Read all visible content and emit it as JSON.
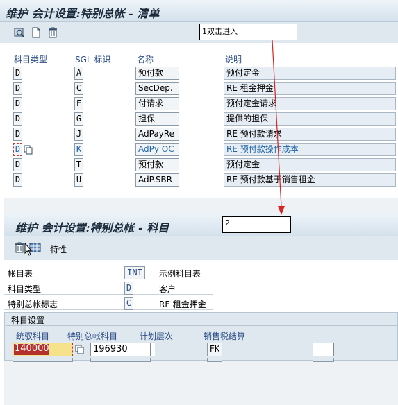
{
  "list_view": {
    "title": "维护 会计设置:特别总帐 - 清单",
    "callout": "1双击进入",
    "columns": {
      "type": "科目类型",
      "sgl": "SGL 标识",
      "name": "名称",
      "desc": "说明"
    },
    "rows": [
      {
        "type": "D",
        "sgl": "A",
        "name": "预付款",
        "desc": "预付定金"
      },
      {
        "type": "D",
        "sgl": "C",
        "name": "SecDep.",
        "desc": "RE 租金押金"
      },
      {
        "type": "D",
        "sgl": "F",
        "name": "付请求",
        "desc": "预付定金请求"
      },
      {
        "type": "D",
        "sgl": "G",
        "name": "担保",
        "desc": "提供的担保"
      },
      {
        "type": "D",
        "sgl": "J",
        "name": "AdPayRe",
        "desc": "RE 预付款请求"
      },
      {
        "type": "D",
        "sgl": "K",
        "name": "AdPy OC",
        "desc": "RE 预付款操作成本"
      },
      {
        "type": "D",
        "sgl": "T",
        "name": "预付款",
        "desc": "预付定金"
      },
      {
        "type": "D",
        "sgl": "U",
        "name": "AdP.SBR",
        "desc": "RE 预付款基于销售租金"
      }
    ]
  },
  "detail_view": {
    "title": "维护 会计设置:特别总帐 - 科目",
    "callout": "2",
    "toolbar": {
      "properties_label": "特性"
    },
    "fields": {
      "chart_label": "帐目表",
      "chart_value": "INT",
      "chart_desc": "示例科目表",
      "type_label": "科目类型",
      "type_value": "D",
      "type_desc": "客户",
      "sgl_label": "特别总帐标志",
      "sgl_value": "C",
      "sgl_desc": "RE 租金押金"
    },
    "account_settings": {
      "section_title": "科目设置",
      "col_recon": "统驭科目",
      "col_special": "特别总帐科目",
      "col_level": "计划层次",
      "col_tax": "销售税结算",
      "recon_value": "140000",
      "special_value": "196930",
      "tax_value": "FK"
    }
  }
}
